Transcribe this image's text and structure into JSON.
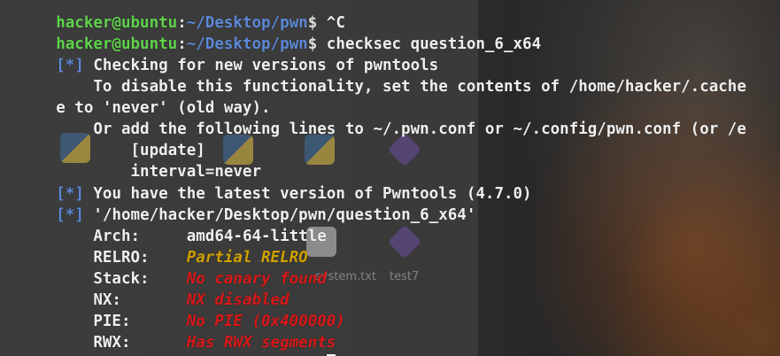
{
  "prompt": {
    "user_host": "hacker@ubuntu",
    "colon": ":",
    "path": "~/Desktop/pwn",
    "symbol": "$"
  },
  "lines": {
    "l1_cmd": " ^C",
    "l2_cmd": " checksec question_6_x64",
    "l3_bracket_open": "[",
    "l3_star": "*",
    "l3_bracket_close": "]",
    "l3_text": " Checking for new versions of pwntools",
    "l4_text": "    To disable this functionality, set the contents of /home/hacker/.cache",
    "l5_text": "e to 'never' (old way).",
    "l6_text": "    Or add the following lines to ~/.pwn.conf or ~/.config/pwn.conf (or /e",
    "l7_text": "        [update]",
    "l8_text": "        interval=never",
    "l9_text": " You have the latest version of Pwntools (4.7.0)",
    "l10_text": " '/home/hacker/Desktop/pwn/question_6_x64'"
  },
  "checksec": {
    "arch_label": "    Arch:     ",
    "arch_value": "amd64-64-little",
    "relro_label": "    RELRO:    ",
    "relro_value": "Partial RELRO",
    "stack_label": "    Stack:    ",
    "stack_value": "No canary found",
    "nx_label": "    NX:       ",
    "nx_value": "NX disabled",
    "pie_label": "    PIE:      ",
    "pie_value": "No PIE (0x400000)",
    "rwx_label": "    RWX:      ",
    "rwx_value": "Has RWX segments"
  },
  "final_prompt_cmd": " ",
  "desktop_ghost_labels": {
    "g1": "system.txt",
    "g2": "test7"
  },
  "colors": {
    "user": "#5fd34b",
    "path": "#5c88d6",
    "warning": "#d0a000",
    "danger": "#d81818"
  }
}
